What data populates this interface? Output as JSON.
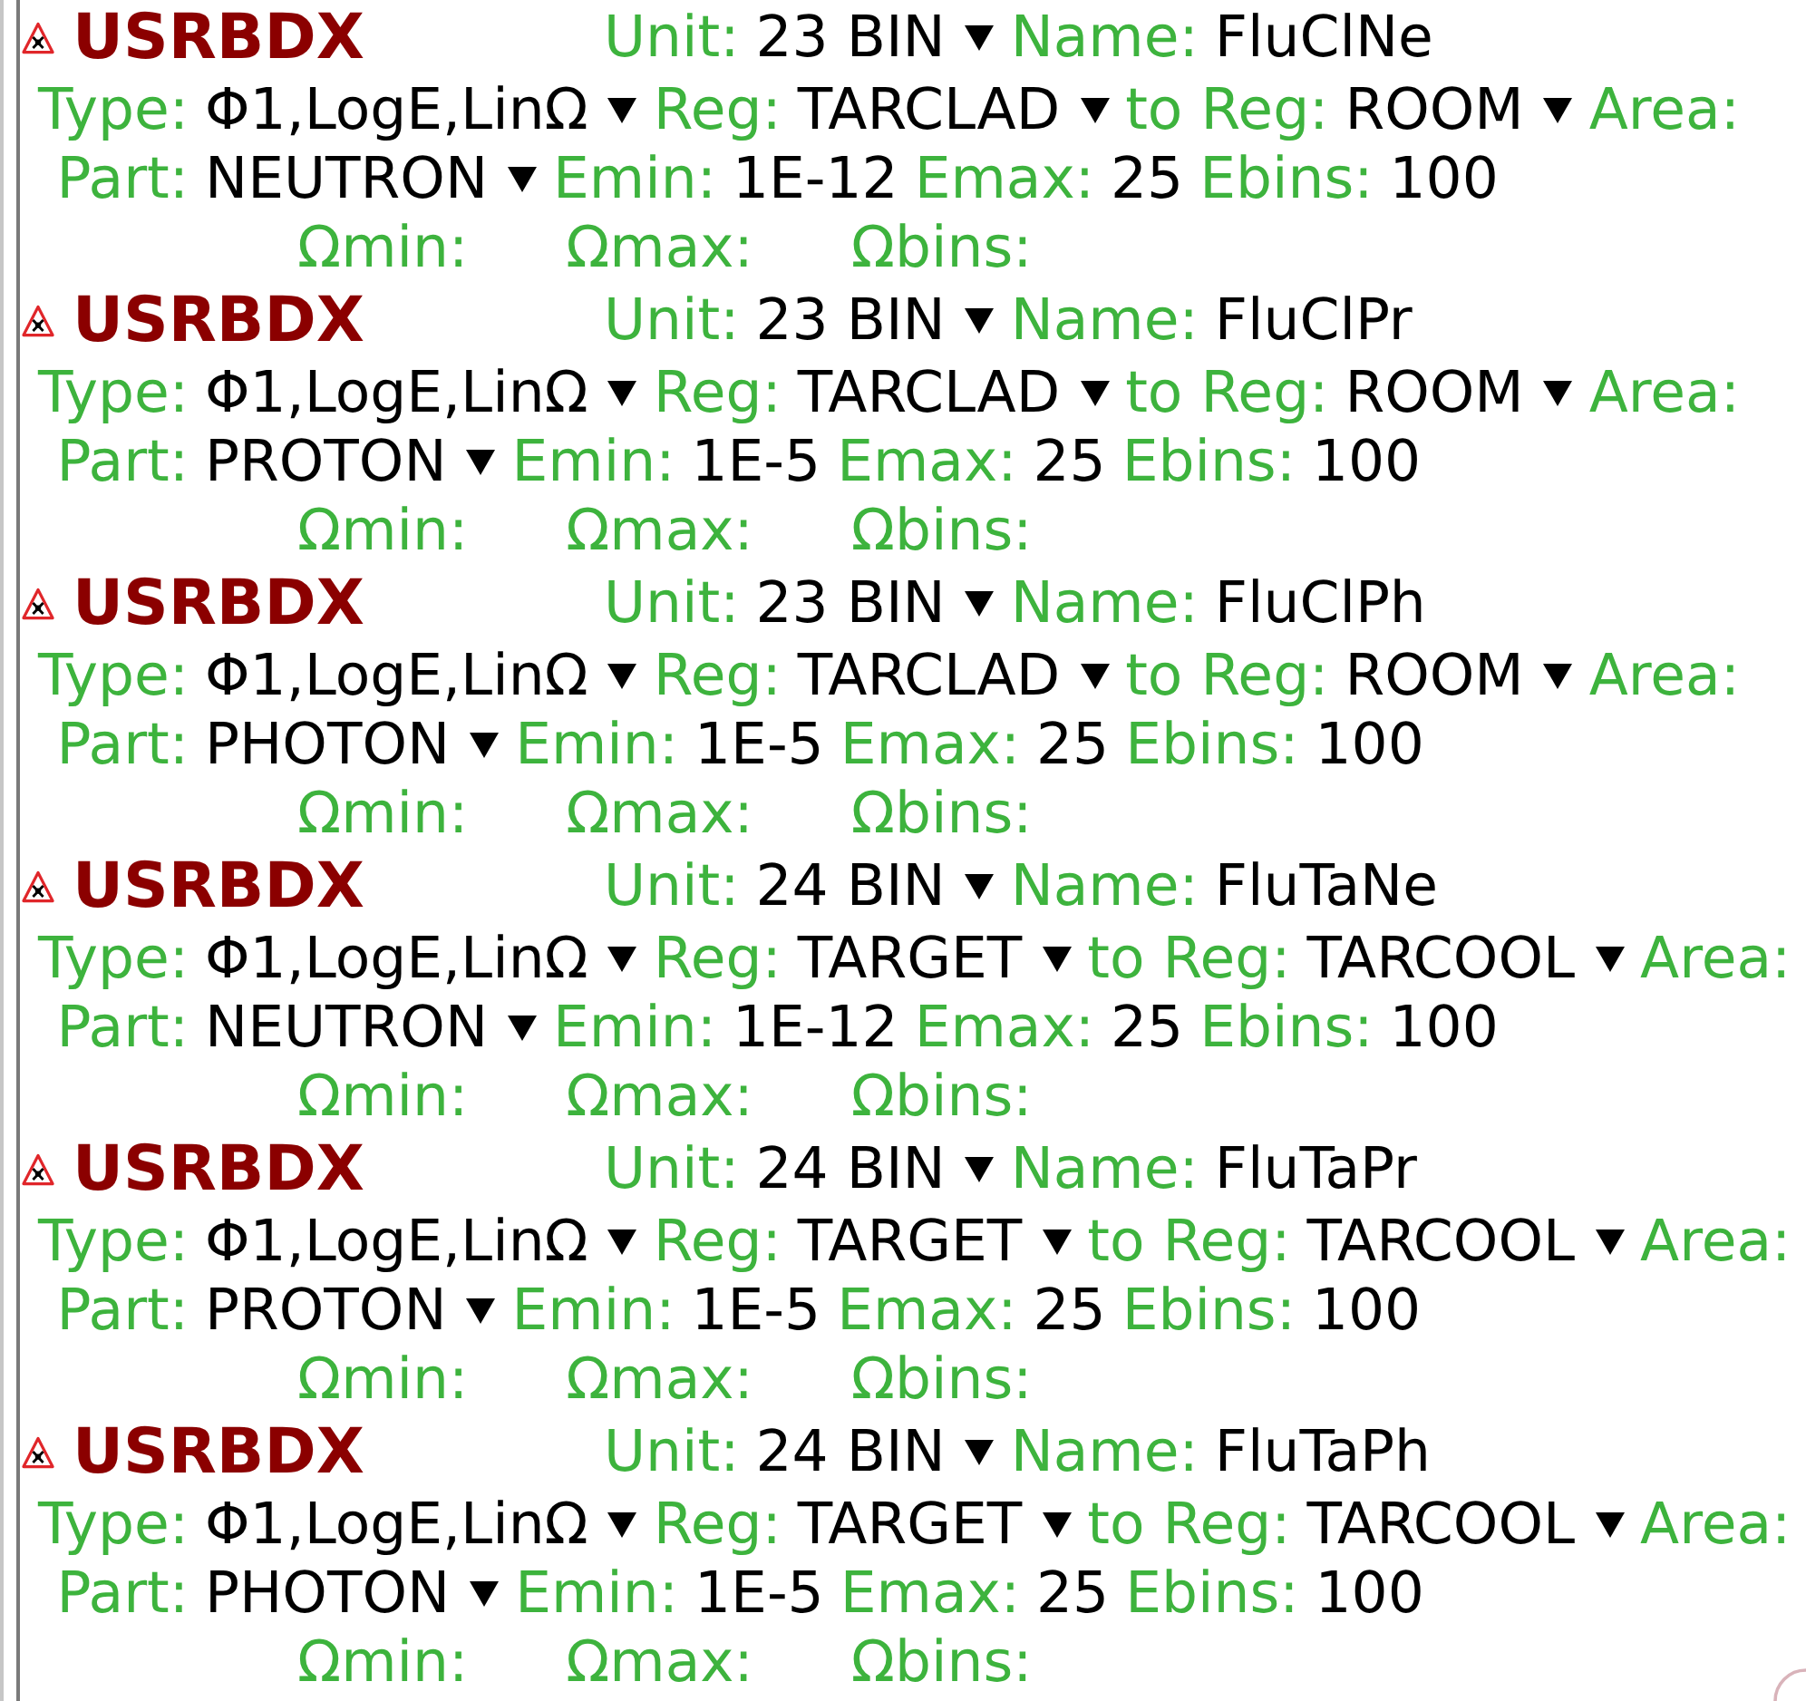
{
  "cards": [
    {
      "title": "USRBDX",
      "header_fields": [
        {
          "label": "Unit:",
          "value": "23 BIN",
          "kind": "dropdown"
        },
        {
          "label": "Name:",
          "value": "FluClNe",
          "kind": "entry"
        }
      ],
      "lines": [
        {
          "fields": [
            {
              "label": "Type:",
              "value": "Φ1,LogE,LinΩ",
              "kind": "dropdown"
            },
            {
              "label": "Reg:",
              "value": "TARCLAD",
              "kind": "dropdown"
            },
            {
              "label": "to Reg:",
              "value": "ROOM",
              "kind": "dropdown"
            },
            {
              "label": "Area:",
              "kind": "blank"
            }
          ]
        },
        {
          "fields": [
            {
              "label": "Part:",
              "value": "NEUTRON",
              "kind": "dropdown"
            },
            {
              "label": "Emin:",
              "value": "1E-12",
              "kind": "entry"
            },
            {
              "label": "Emax:",
              "value": "25",
              "kind": "entry"
            },
            {
              "label": "Ebins:",
              "value": "100",
              "kind": "entry"
            }
          ]
        },
        {
          "fields": [
            {
              "label": "Ωmin:",
              "kind": "blank"
            },
            {
              "label": "Ωmax:",
              "kind": "blank"
            },
            {
              "label": "Ωbins:",
              "kind": "blank"
            }
          ]
        }
      ]
    },
    {
      "title": "USRBDX",
      "header_fields": [
        {
          "label": "Unit:",
          "value": "23 BIN",
          "kind": "dropdown"
        },
        {
          "label": "Name:",
          "value": "FluClPr",
          "kind": "entry"
        }
      ],
      "lines": [
        {
          "fields": [
            {
              "label": "Type:",
              "value": "Φ1,LogE,LinΩ",
              "kind": "dropdown"
            },
            {
              "label": "Reg:",
              "value": "TARCLAD",
              "kind": "dropdown"
            },
            {
              "label": "to Reg:",
              "value": "ROOM",
              "kind": "dropdown"
            },
            {
              "label": "Area:",
              "kind": "blank"
            }
          ]
        },
        {
          "fields": [
            {
              "label": "Part:",
              "value": "PROTON",
              "kind": "dropdown"
            },
            {
              "label": "Emin:",
              "value": "1E-5",
              "kind": "entry"
            },
            {
              "label": "Emax:",
              "value": "25",
              "kind": "entry"
            },
            {
              "label": "Ebins:",
              "value": "100",
              "kind": "entry"
            }
          ]
        },
        {
          "fields": [
            {
              "label": "Ωmin:",
              "kind": "blank"
            },
            {
              "label": "Ωmax:",
              "kind": "blank"
            },
            {
              "label": "Ωbins:",
              "kind": "blank"
            }
          ]
        }
      ]
    },
    {
      "title": "USRBDX",
      "header_fields": [
        {
          "label": "Unit:",
          "value": "23 BIN",
          "kind": "dropdown"
        },
        {
          "label": "Name:",
          "value": "FluClPh",
          "kind": "entry"
        }
      ],
      "lines": [
        {
          "fields": [
            {
              "label": "Type:",
              "value": "Φ1,LogE,LinΩ",
              "kind": "dropdown"
            },
            {
              "label": "Reg:",
              "value": "TARCLAD",
              "kind": "dropdown"
            },
            {
              "label": "to Reg:",
              "value": "ROOM",
              "kind": "dropdown"
            },
            {
              "label": "Area:",
              "kind": "blank"
            }
          ]
        },
        {
          "fields": [
            {
              "label": "Part:",
              "value": "PHOTON",
              "kind": "dropdown"
            },
            {
              "label": "Emin:",
              "value": "1E-5",
              "kind": "entry"
            },
            {
              "label": "Emax:",
              "value": "25",
              "kind": "entry"
            },
            {
              "label": "Ebins:",
              "value": "100",
              "kind": "entry"
            }
          ]
        },
        {
          "fields": [
            {
              "label": "Ωmin:",
              "kind": "blank"
            },
            {
              "label": "Ωmax:",
              "kind": "blank"
            },
            {
              "label": "Ωbins:",
              "kind": "blank"
            }
          ]
        }
      ]
    },
    {
      "title": "USRBDX",
      "header_fields": [
        {
          "label": "Unit:",
          "value": "24 BIN",
          "kind": "dropdown"
        },
        {
          "label": "Name:",
          "value": "FluTaNe",
          "kind": "entry"
        }
      ],
      "lines": [
        {
          "fields": [
            {
              "label": "Type:",
              "value": "Φ1,LogE,LinΩ",
              "kind": "dropdown"
            },
            {
              "label": "Reg:",
              "value": "TARGET",
              "kind": "dropdown"
            },
            {
              "label": "to Reg:",
              "value": "TARCOOL",
              "kind": "dropdown"
            },
            {
              "label": "Area:",
              "kind": "blank"
            }
          ]
        },
        {
          "fields": [
            {
              "label": "Part:",
              "value": "NEUTRON",
              "kind": "dropdown"
            },
            {
              "label": "Emin:",
              "value": "1E-12",
              "kind": "entry"
            },
            {
              "label": "Emax:",
              "value": "25",
              "kind": "entry"
            },
            {
              "label": "Ebins:",
              "value": "100",
              "kind": "entry"
            }
          ]
        },
        {
          "fields": [
            {
              "label": "Ωmin:",
              "kind": "blank"
            },
            {
              "label": "Ωmax:",
              "kind": "blank"
            },
            {
              "label": "Ωbins:",
              "kind": "blank"
            }
          ]
        }
      ]
    },
    {
      "title": "USRBDX",
      "header_fields": [
        {
          "label": "Unit:",
          "value": "24 BIN",
          "kind": "dropdown"
        },
        {
          "label": "Name:",
          "value": "FluTaPr",
          "kind": "entry"
        }
      ],
      "lines": [
        {
          "fields": [
            {
              "label": "Type:",
              "value": "Φ1,LogE,LinΩ",
              "kind": "dropdown"
            },
            {
              "label": "Reg:",
              "value": "TARGET",
              "kind": "dropdown"
            },
            {
              "label": "to Reg:",
              "value": "TARCOOL",
              "kind": "dropdown"
            },
            {
              "label": "Area:",
              "kind": "blank"
            }
          ]
        },
        {
          "fields": [
            {
              "label": "Part:",
              "value": "PROTON",
              "kind": "dropdown"
            },
            {
              "label": "Emin:",
              "value": "1E-5",
              "kind": "entry"
            },
            {
              "label": "Emax:",
              "value": "25",
              "kind": "entry"
            },
            {
              "label": "Ebins:",
              "value": "100",
              "kind": "entry"
            }
          ]
        },
        {
          "fields": [
            {
              "label": "Ωmin:",
              "kind": "blank"
            },
            {
              "label": "Ωmax:",
              "kind": "blank"
            },
            {
              "label": "Ωbins:",
              "kind": "blank"
            }
          ]
        }
      ]
    },
    {
      "title": "USRBDX",
      "header_fields": [
        {
          "label": "Unit:",
          "value": "24 BIN",
          "kind": "dropdown"
        },
        {
          "label": "Name:",
          "value": "FluTaPh",
          "kind": "entry"
        }
      ],
      "lines": [
        {
          "fields": [
            {
              "label": "Type:",
              "value": "Φ1,LogE,LinΩ",
              "kind": "dropdown"
            },
            {
              "label": "Reg:",
              "value": "TARGET",
              "kind": "dropdown"
            },
            {
              "label": "to Reg:",
              "value": "TARCOOL",
              "kind": "dropdown"
            },
            {
              "label": "Area:",
              "kind": "blank"
            }
          ]
        },
        {
          "fields": [
            {
              "label": "Part:",
              "value": "PHOTON",
              "kind": "dropdown"
            },
            {
              "label": "Emin:",
              "value": "1E-5",
              "kind": "entry"
            },
            {
              "label": "Emax:",
              "value": "25",
              "kind": "entry"
            },
            {
              "label": "Ebins:",
              "value": "100",
              "kind": "entry"
            }
          ]
        },
        {
          "fields": [
            {
              "label": "Ωmin:",
              "kind": "blank"
            },
            {
              "label": "Ωmax:",
              "kind": "blank"
            },
            {
              "label": "Ωbins:",
              "kind": "blank"
            }
          ]
        }
      ]
    }
  ]
}
